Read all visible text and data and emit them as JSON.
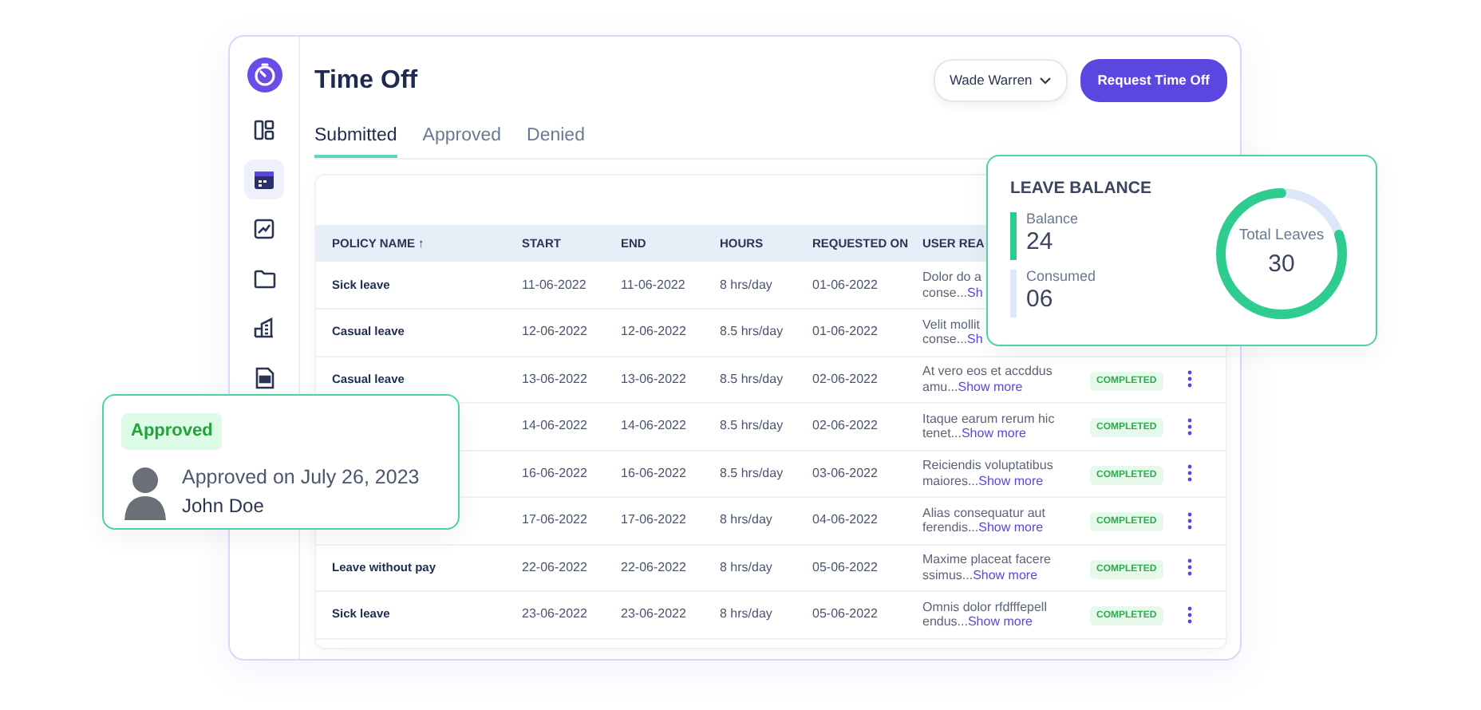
{
  "sidebar": {
    "items": [
      {
        "kind": "layout",
        "selected": false
      },
      {
        "kind": "calendar",
        "selected": true
      },
      {
        "kind": "chart",
        "selected": false
      },
      {
        "kind": "folder",
        "selected": false
      },
      {
        "kind": "building",
        "selected": false
      },
      {
        "kind": "document",
        "selected": false
      }
    ]
  },
  "header": {
    "title": "Time Off",
    "user_menu": "Wade Warren",
    "primary_button": "Request Time Off"
  },
  "tabs": [
    {
      "label": "Submitted",
      "selected": true
    },
    {
      "label": "Approved",
      "selected": false
    },
    {
      "label": "Denied",
      "selected": false
    }
  ],
  "table": {
    "columns": [
      "POLICY NAME ↑",
      "START",
      "END",
      "HOURS",
      "REQUESTED ON",
      "USER REA"
    ],
    "rows": [
      {
        "policy": "Sick leave",
        "start": "11-06-2022",
        "end": "11-06-2022",
        "hours": "8 hrs/day",
        "requested": "01-06-2022",
        "reason_lines": [
          "Dolor do a",
          "conse..."
        ],
        "link": "Sh",
        "menu": false
      },
      {
        "policy": "Casual leave",
        "start": "12-06-2022",
        "end": "12-06-2022",
        "hours": "8.5 hrs/day",
        "requested": "01-06-2022",
        "reason_lines": [
          "Velit mollit",
          "conse..."
        ],
        "link": "Sh",
        "menu": false
      },
      {
        "policy": "Casual leave",
        "start": "13-06-2022",
        "end": "13-06-2022",
        "hours": "8.5 hrs/day",
        "requested": "02-06-2022",
        "reason_lines": [
          "At vero eos et accddus",
          "amu..."
        ],
        "link": "Show more",
        "status": "COMPLETED",
        "menu": true
      },
      {
        "start": "14-06-2022",
        "end": "14-06-2022",
        "hours": "8.5 hrs/day",
        "requested": "02-06-2022",
        "reason_lines": [
          "Itaque earum rerum hic",
          "tenet..."
        ],
        "link": "Show more",
        "status": "COMPLETED",
        "menu": true
      },
      {
        "start": "16-06-2022",
        "end": "16-06-2022",
        "hours": "8.5 hrs/day",
        "requested": "03-06-2022",
        "reason_lines": [
          "Reiciendis voluptatibus",
          "maiores..."
        ],
        "link": "Show more",
        "status": "COMPLETED",
        "menu": true
      },
      {
        "start": "17-06-2022",
        "end": "17-06-2022",
        "hours": "8 hrs/day",
        "requested": "04-06-2022",
        "reason_lines": [
          "Alias consequatur aut",
          "ferendis..."
        ],
        "link": "Show more",
        "status": "COMPLETED",
        "menu": true
      },
      {
        "policy": "Leave without pay",
        "start": "22-06-2022",
        "end": "22-06-2022",
        "hours": "8 hrs/day",
        "requested": "05-06-2022",
        "reason_lines": [
          "Maxime placeat facere",
          "ssimus..."
        ],
        "link": "Show more",
        "status": "COMPLETED",
        "menu": true
      },
      {
        "policy": "Sick leave",
        "start": "23-06-2022",
        "end": "23-06-2022",
        "hours": "8 hrs/day",
        "requested": "05-06-2022",
        "reason_lines": [
          "Omnis dolor rfdfffepell",
          "endus..."
        ],
        "link": "Show more",
        "status": "COMPLETED",
        "menu": true
      }
    ]
  },
  "leave_balance": {
    "title": "LEAVE BALANCE",
    "stats": [
      {
        "label": "Balance",
        "value": "24",
        "color": "#2ecc8f"
      },
      {
        "label": "Consumed",
        "value": "06",
        "color": "#dde7f7"
      }
    ],
    "donut_label": "Total Leaves",
    "donut_value": "30",
    "level": 0.8
  },
  "approval_card": {
    "badge": "Approved",
    "text": "Approved on July 26, 2023",
    "name": "John Doe"
  }
}
